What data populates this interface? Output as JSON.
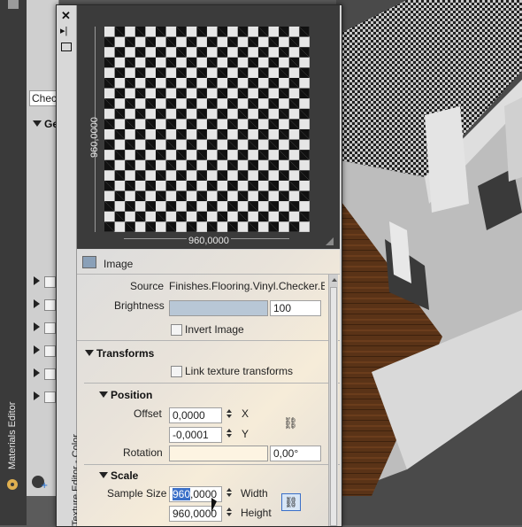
{
  "left_palette": {
    "title": "Materials Editor",
    "dropdown_value": "Chec",
    "section_label": "Ge"
  },
  "editor": {
    "side_title": "Texture Editor - Color",
    "preview": {
      "width_value": "960,0000",
      "height_value": "960,0000"
    },
    "image_section": {
      "label": "Image",
      "source_label": "Source",
      "source_value": "Finishes.Flooring.Vinyl.Checker.B",
      "brightness_label": "Brightness",
      "brightness_value": "100",
      "brightness_fraction": 1.0,
      "invert_label": "Invert Image"
    },
    "transforms": {
      "label": "Transforms",
      "link_label": "Link texture transforms"
    },
    "position": {
      "label": "Position",
      "offset_label": "Offset",
      "offset_x": "0,0000",
      "offset_y": "-0,0001",
      "x_label": "X",
      "y_label": "Y",
      "rotation_label": "Rotation",
      "rotation_value": "0,00°"
    },
    "scale": {
      "label": "Scale",
      "sample_size_label": "Sample Size",
      "width_selected": "960",
      "width_rest": ",0000",
      "height_value": "960,0000",
      "width_label": "Width",
      "height_label": "Height"
    }
  },
  "colors": {
    "selection": "#3a6fc8",
    "slider_fill": "#b8c7d6"
  }
}
